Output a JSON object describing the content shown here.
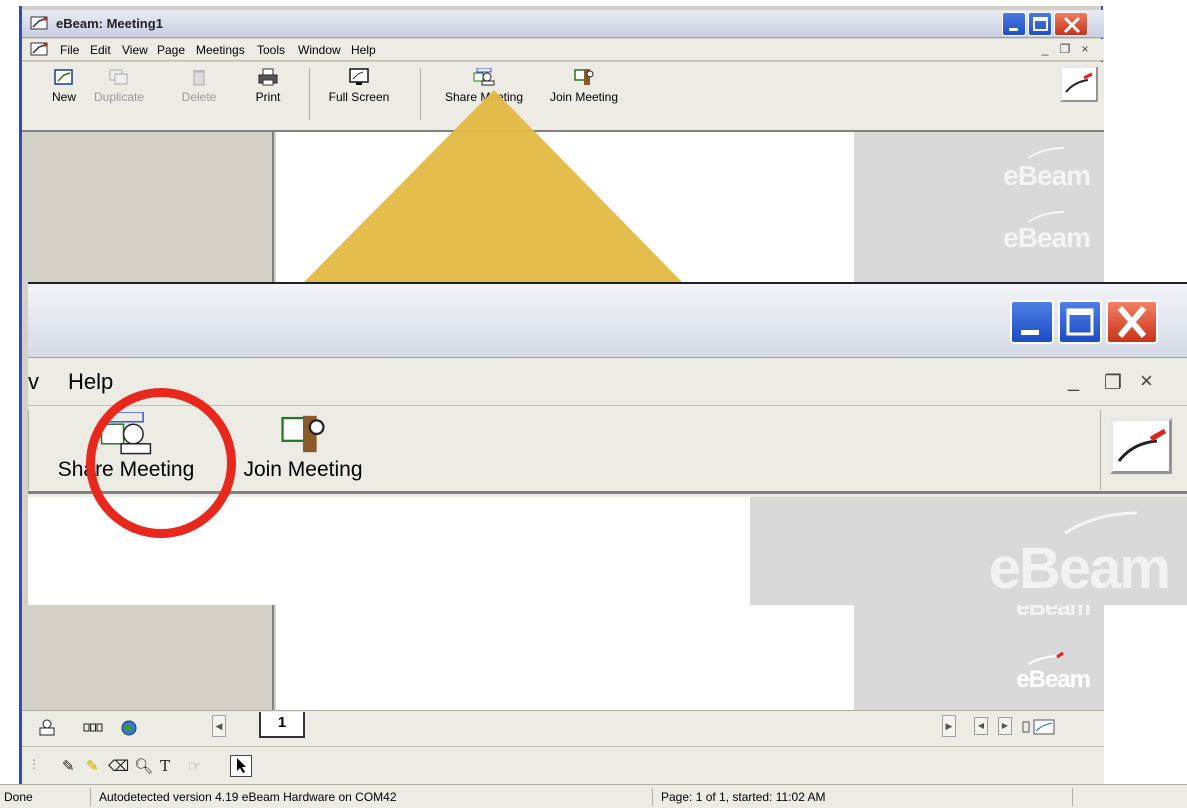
{
  "window": {
    "title": "eBeam: Meeting1"
  },
  "menubar": {
    "items": [
      "File",
      "Edit",
      "View",
      "Page",
      "Meetings",
      "Tools",
      "Window",
      "Help"
    ]
  },
  "toolbar": {
    "new_label": "New",
    "duplicate_label": "Duplicate",
    "delete_label": "Delete",
    "print_label": "Print",
    "fullscreen_label": "Full Screen",
    "share_label": "Share Meeting",
    "join_label": "Join Meeting"
  },
  "watermark": {
    "text": "eBeam"
  },
  "pagebar": {
    "current_page": "1"
  },
  "statusbar": {
    "state": "Done",
    "hardware": "Autodetected version 4.19 eBeam Hardware on COM42",
    "page_info": "Page: 1 of 1, started: 11:02 AM"
  },
  "zoom": {
    "menu_partial": "v",
    "menu_help": "Help",
    "share_label": "Share Meeting",
    "join_label": "Join Meeting"
  },
  "colors": {
    "highlight_circle": "#e8281c",
    "spotlight_beam": "#e3b943",
    "xp_blue": "#2b4eb8",
    "close_red": "#d5462a"
  }
}
